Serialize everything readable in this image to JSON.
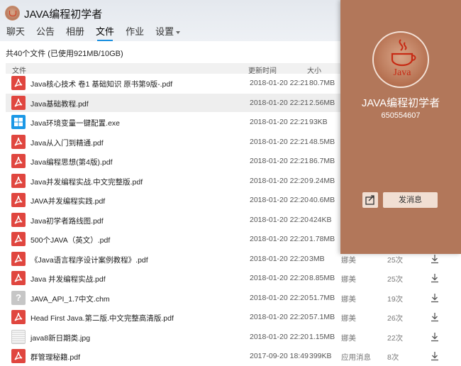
{
  "header": {
    "title": "JAVA编程初学者",
    "tabs": [
      "聊天",
      "公告",
      "相册",
      "文件",
      "作业",
      "设置"
    ],
    "active_tab": "文件"
  },
  "files": {
    "summary": "共40个文件 (已使用921MB/10GB)",
    "columns": {
      "name": "文件",
      "time": "更新时间",
      "size": "大小"
    },
    "rows": [
      {
        "icon": "pdf",
        "name": "Java核心技术 卷1 基础知识 原书第9版-.pdf",
        "time": "2018-01-20 22:21",
        "size": "80.7MB",
        "uploader": "",
        "downloads": ""
      },
      {
        "icon": "pdf",
        "name": "Java基础教程.pdf",
        "time": "2018-01-20 22:21",
        "size": "2.56MB",
        "uploader": "",
        "downloads": ""
      },
      {
        "icon": "exe",
        "name": "Java环境变量一键配置.exe",
        "time": "2018-01-20 22:21",
        "size": "93KB",
        "uploader": "",
        "downloads": ""
      },
      {
        "icon": "pdf",
        "name": "Java从入门到精通.pdf",
        "time": "2018-01-20 22:21",
        "size": "48.5MB",
        "uploader": "",
        "downloads": ""
      },
      {
        "icon": "pdf",
        "name": "Java编程思想(第4版).pdf",
        "time": "2018-01-20 22:21",
        "size": "86.7MB",
        "uploader": "",
        "downloads": ""
      },
      {
        "icon": "pdf",
        "name": "Java并发编程实战.中文完整版.pdf",
        "time": "2018-01-20 22:20",
        "size": "9.24MB",
        "uploader": "",
        "downloads": ""
      },
      {
        "icon": "pdf",
        "name": "JAVA并发编程实践.pdf",
        "time": "2018-01-20 22:20",
        "size": "40.6MB",
        "uploader": "",
        "downloads": ""
      },
      {
        "icon": "pdf",
        "name": "Java初学者路线图.pdf",
        "time": "2018-01-20 22:20",
        "size": "424KB",
        "uploader": "",
        "downloads": ""
      },
      {
        "icon": "pdf",
        "name": "500个JAVA（英文）.pdf",
        "time": "2018-01-20 22:20",
        "size": "1.78MB",
        "uploader": "",
        "downloads": ""
      },
      {
        "icon": "pdf",
        "name": "《Java语言程序设计案例教程》.pdf",
        "time": "2018-01-20 22:20",
        "size": "3MB",
        "uploader": "娜美",
        "downloads": "25次"
      },
      {
        "icon": "pdf",
        "name": "Java 并发编程实战.pdf",
        "time": "2018-01-20 22:20",
        "size": "8.85MB",
        "uploader": "娜美",
        "downloads": "25次"
      },
      {
        "icon": "chm",
        "name": "JAVA_API_1.7中文.chm",
        "time": "2018-01-20 22:20",
        "size": "51.7MB",
        "uploader": "娜美",
        "downloads": "19次"
      },
      {
        "icon": "pdf",
        "name": "Head First Java.第二版.中文完整高清版.pdf",
        "time": "2018-01-20 22:20",
        "size": "57.1MB",
        "uploader": "娜美",
        "downloads": "26次"
      },
      {
        "icon": "jpg",
        "name": "java8新日期类.jpg",
        "time": "2018-01-20 22:20",
        "size": "1.15MB",
        "uploader": "娜美",
        "downloads": "22次"
      },
      {
        "icon": "pdf",
        "name": "群管理秘籍.pdf",
        "time": "2017-09-20 18:49",
        "size": "399KB",
        "uploader": "应用消息",
        "downloads": "8次"
      }
    ]
  },
  "profile": {
    "avatar_text": "Java",
    "name": "JAVA编程初学者",
    "id": "650554607",
    "message_button": "发消息"
  },
  "colors": {
    "panel": "#b2775a",
    "pdf": "#e0463f",
    "exe": "#1b98e6",
    "accent": "#1a8fe0"
  }
}
